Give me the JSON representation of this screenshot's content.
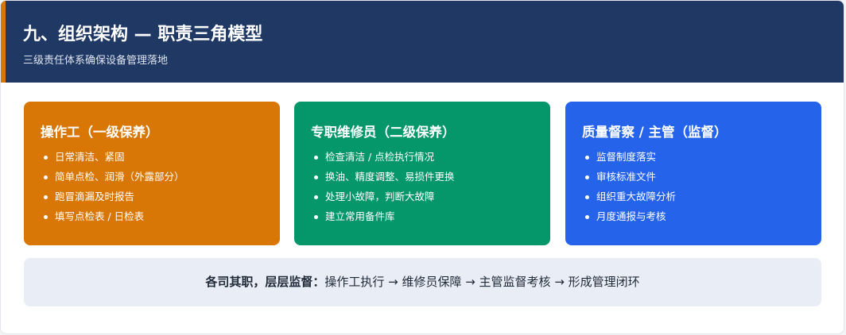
{
  "header": {
    "title": "九、组织架构 — 职责三角模型",
    "subtitle": "三级责任体系确保设备管理落地",
    "accent_color": "#d97706",
    "background_color": "#1f3864"
  },
  "cards": [
    {
      "title": "操作工（一级保养）",
      "color": "#d97706",
      "items": [
        "日常清洁、紧固",
        "简单点检、润滑（外露部分）",
        "跑冒滴漏及时报告",
        "填写点检表 / 日检表"
      ]
    },
    {
      "title": "专职维修员（二级保养）",
      "color": "#059669",
      "items": [
        "检查清洁 / 点检执行情况",
        "换油、精度调整、易损件更换",
        "处理小故障，判断大故障",
        "建立常用备件库"
      ]
    },
    {
      "title": "质量督察 / 主管（监督）",
      "color": "#2563eb",
      "items": [
        "监督制度落实",
        "审核标准文件",
        "组织重大故障分析",
        "月度通报与考核"
      ]
    }
  ],
  "banner": {
    "emphasis": "各司其职，层层监督：",
    "text": "操作工执行 → 维修员保障 → 主管监督考核 → 形成管理闭环"
  }
}
